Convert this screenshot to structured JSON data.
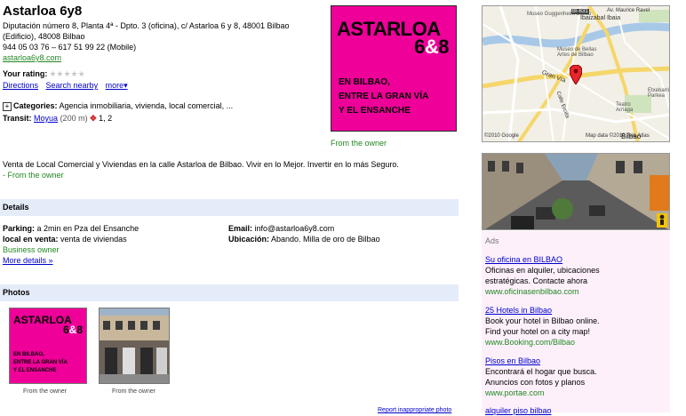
{
  "business": {
    "name": "Astarloa 6y8",
    "address_line1": "Diputación número 8, Planta 4ª - Dpto. 3 (oficina), c/ Astarloa 6 y 8, 48001 Bilbao",
    "address_line2": "(Edificio), 48008 Bilbao",
    "phone": "944 05 03 76 – 617 51 99 22 (Mobile)",
    "website": "astarloa6y8.com",
    "rating_label": "Your rating:",
    "stars": "★★★★★",
    "links": {
      "directions": "Directions",
      "search_nearby": "Search nearby",
      "more": "more▾"
    },
    "categories_label": "Categories:",
    "categories_value": "Agencia inmobiliaria, vivienda, local comercial, ...",
    "transit_label": "Transit:",
    "transit_station": "Moyua",
    "transit_distance": "(200 m)",
    "transit_lines": "1, 2",
    "metro_icon": "metro-icon"
  },
  "promo": {
    "brand": "ASTARLOA",
    "brand_num": "6",
    "brand_amp": "&",
    "brand_num2": "8",
    "line1": "EN BILBAO,",
    "line2": "ENTRE LA GRAN VÍA",
    "line3": "Y EL ENSANCHE",
    "from_owner": "From the owner",
    "bg": "#ee0099"
  },
  "description": {
    "text": "Venta de Local Comercial y Viviendas en la calle Astarloa de Bilbao. Vivir en lo Mejor. Invertir en lo más Seguro.",
    "from_owner": "- From the owner"
  },
  "details": {
    "header": "Details",
    "parking_label": "Parking:",
    "parking_value": "a 2min en Pza del Ensanche",
    "local_label": "local en venta:",
    "local_value": "venta de viviendas",
    "owner_label": "Business owner",
    "more_details": "More details »",
    "email_label": "Email:",
    "email_value": "info@astarloa6y8.com",
    "ubicacion_label": "Ubicación:",
    "ubicacion_value": "Abando. Milla de oro de Bilbao"
  },
  "photos": {
    "header": "Photos",
    "caption1": "From the owner",
    "caption2": "From the owner",
    "report": "Report inappropriate photo"
  },
  "map": {
    "labels": {
      "road1": "BI-631",
      "road2": "Av. Maurice Ravel",
      "gugg": "Museo Guggenheim Bilbao",
      "ibaizabal": "Ibaizabal Ibaia",
      "bellas": "Museo de Bellas Artes de Bilbao",
      "granvia": "Gran Vía",
      "ercilla": "Calle Ercilla",
      "teatro": "Teatro Arriaga",
      "etxebarria": "Etxebarri Parkea",
      "copyright": "©2010 Google",
      "mapdata": "Map data ©2010 Tele Atlas",
      "bilbao": "Bilbao"
    }
  },
  "ads": {
    "header": "Ads",
    "items": [
      {
        "title": "Su oficina en BILBAO",
        "line1": "Oficinas en alquiler, ubicaciones",
        "line2": "estratégicas. Contacte ahora",
        "url": "www.oficinasenbilbao.com"
      },
      {
        "title": "25 Hotels in Bilbao",
        "line1": "Book your hotel in Bilbao online.",
        "line2": "Find your hotel on a city map!",
        "url": "www.Booking.com/Bilbao"
      },
      {
        "title": "Pisos en Bilbao",
        "line1": "Encontrará el hogar que busca.",
        "line2": "Anuncios con fotos y planos",
        "url": "www.portae.com"
      },
      {
        "title": "alquiler piso bilbao"
      }
    ]
  }
}
